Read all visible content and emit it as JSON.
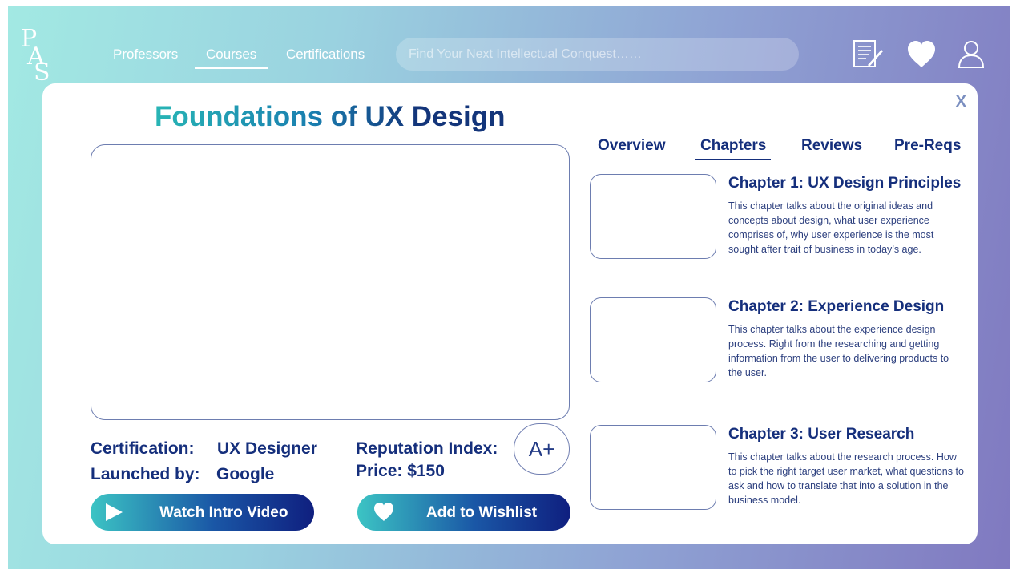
{
  "brand": {
    "letters": [
      "P",
      "A",
      "S"
    ]
  },
  "nav": {
    "items": [
      {
        "label": "Professors"
      },
      {
        "label": "Courses",
        "active": true
      },
      {
        "label": "Certifications"
      }
    ]
  },
  "search": {
    "placeholder": "Find Your Next Intellectual Conquest……"
  },
  "header_icons": [
    "notes-icon",
    "heart-icon",
    "user-icon"
  ],
  "course": {
    "title": "Foundations of UX Design",
    "close_label": "X",
    "certification_label": "Certification:",
    "certification_value": "UX Designer",
    "launched_label": "Launched by:",
    "launched_value": "Google",
    "reputation_label": "Reputation Index:",
    "reputation_value": "A+",
    "price_text": "Price: $150",
    "watch_button": "Watch Intro Video",
    "wishlist_button": "Add to Wishlist"
  },
  "tabs": [
    {
      "label": "Overview"
    },
    {
      "label": "Chapters",
      "active": true
    },
    {
      "label": "Reviews"
    },
    {
      "label": "Pre-Reqs"
    }
  ],
  "chapters": [
    {
      "title": "Chapter 1: UX Design Principles",
      "description": "This chapter talks about the original ideas and concepts about design, what user experience comprises of, why user experience is the most sought after trait of business in today’s age."
    },
    {
      "title": "Chapter 2: Experience Design",
      "description": "This chapter talks about the experience design process. Right from the researching and getting information from the user to delivering products to the user."
    },
    {
      "title": "Chapter 3: User Research",
      "description": "This chapter talks about the research process. How to pick the right target user market, what questions to ask and how to translate that into a solution in the business model."
    }
  ],
  "colors": {
    "primary": "#152f7c",
    "accent_teal": "#3cc4c4",
    "border": "#6d7db0",
    "background_start": "#a2e9e3",
    "background_end": "#8079c0"
  }
}
